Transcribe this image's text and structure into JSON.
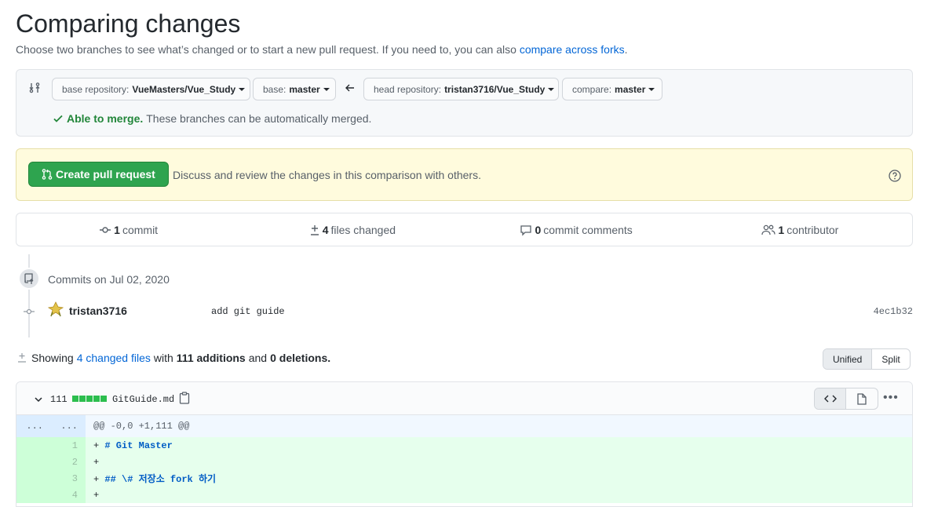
{
  "header": {
    "title": "Comparing changes",
    "subtitle_prefix": "Choose two branches to see what’s changed or to start a new pull request. If you need to, you can also",
    "subtitle_link": "compare across forks",
    "subtitle_suffix": "."
  },
  "range": {
    "base_repo_label": "base repository:",
    "base_repo_value": "VueMasters/Vue_Study",
    "base_label": "base:",
    "base_value": "master",
    "head_repo_label": "head repository:",
    "head_repo_value": "tristan3716/Vue_Study",
    "compare_label": "compare:",
    "compare_value": "master",
    "merge_ok": "Able to merge.",
    "merge_text": "These branches can be automatically merged."
  },
  "pr": {
    "button": "Create pull request",
    "description": "Discuss and review the changes in this comparison with others."
  },
  "summary": {
    "commits_count": "1",
    "commits_label": "commit",
    "files_count": "4",
    "files_label": "files changed",
    "comments_count": "0",
    "comments_label": "commit comments",
    "contributors_count": "1",
    "contributors_label": "contributor"
  },
  "commits": {
    "date": "Commits on Jul 02, 2020",
    "author": "tristan3716",
    "message": "add git guide",
    "sha": "4ec1b32"
  },
  "showing": {
    "prefix": "Showing",
    "files_link": "4 changed files",
    "with": "with",
    "additions": "111 additions",
    "and": "and",
    "deletions": "0 deletions.",
    "unified": "Unified",
    "split": "Split"
  },
  "file": {
    "count": "111",
    "name": "GitGuide.md",
    "hunk_ln_left": "...",
    "hunk_ln_right": "...",
    "hunk": "@@ -0,0 +1,111 @@",
    "lines": [
      {
        "num": "1",
        "prefix": "+ ",
        "text": "# Git Master"
      },
      {
        "num": "2",
        "prefix": "+",
        "text": ""
      },
      {
        "num": "3",
        "prefix": "+ ",
        "text": "## \\# 저장소 fork 하기"
      },
      {
        "num": "4",
        "prefix": "+",
        "text": ""
      }
    ]
  },
  "colors": {
    "accent": "#0366d6",
    "success": "#2ea44f",
    "add_bg": "#e6ffed"
  }
}
